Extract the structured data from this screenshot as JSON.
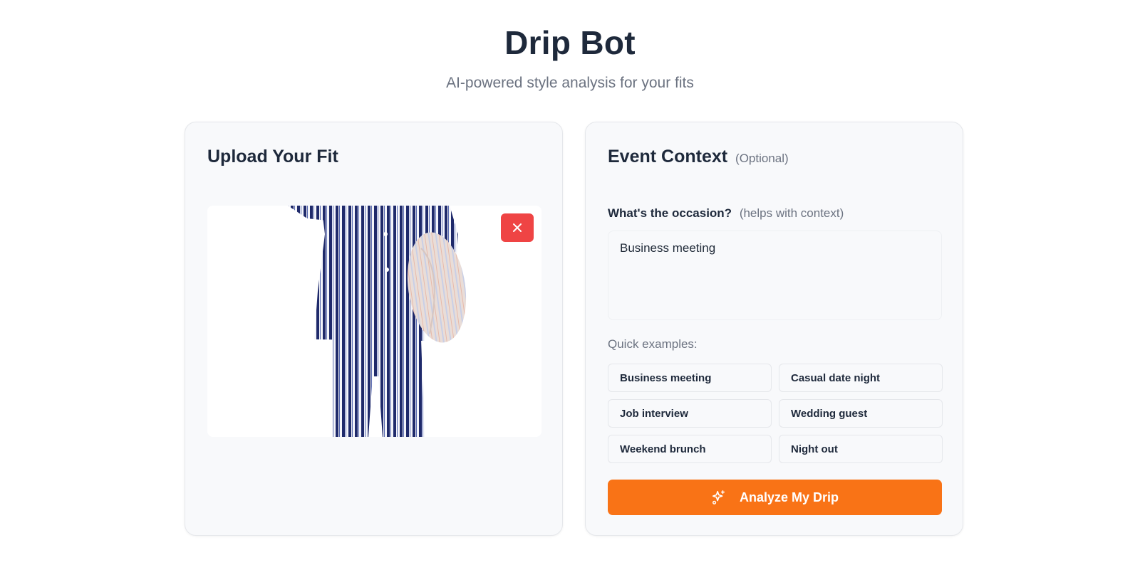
{
  "header": {
    "title": "Drip Bot",
    "subtitle": "AI-powered style analysis for your fits"
  },
  "upload": {
    "title": "Upload Your Fit",
    "image_alt": "striped pajamas outfit with pillow",
    "remove_icon": "close-icon"
  },
  "context": {
    "title": "Event Context",
    "optional_label": "(Optional)",
    "question": "What's the occasion?",
    "hint": "(helps with context)",
    "occasion_value": "Business meeting",
    "examples_label": "Quick examples:",
    "examples": [
      "Business meeting",
      "Casual date night",
      "Job interview",
      "Wedding guest",
      "Weekend brunch",
      "Night out"
    ],
    "analyze_label": "Analyze My Drip",
    "analyze_icon": "sparkles-icon"
  },
  "colors": {
    "accent": "#f97316",
    "danger": "#ef4444",
    "card_bg": "#f8f9fb",
    "stripe_navy": "#1f2a6b"
  }
}
